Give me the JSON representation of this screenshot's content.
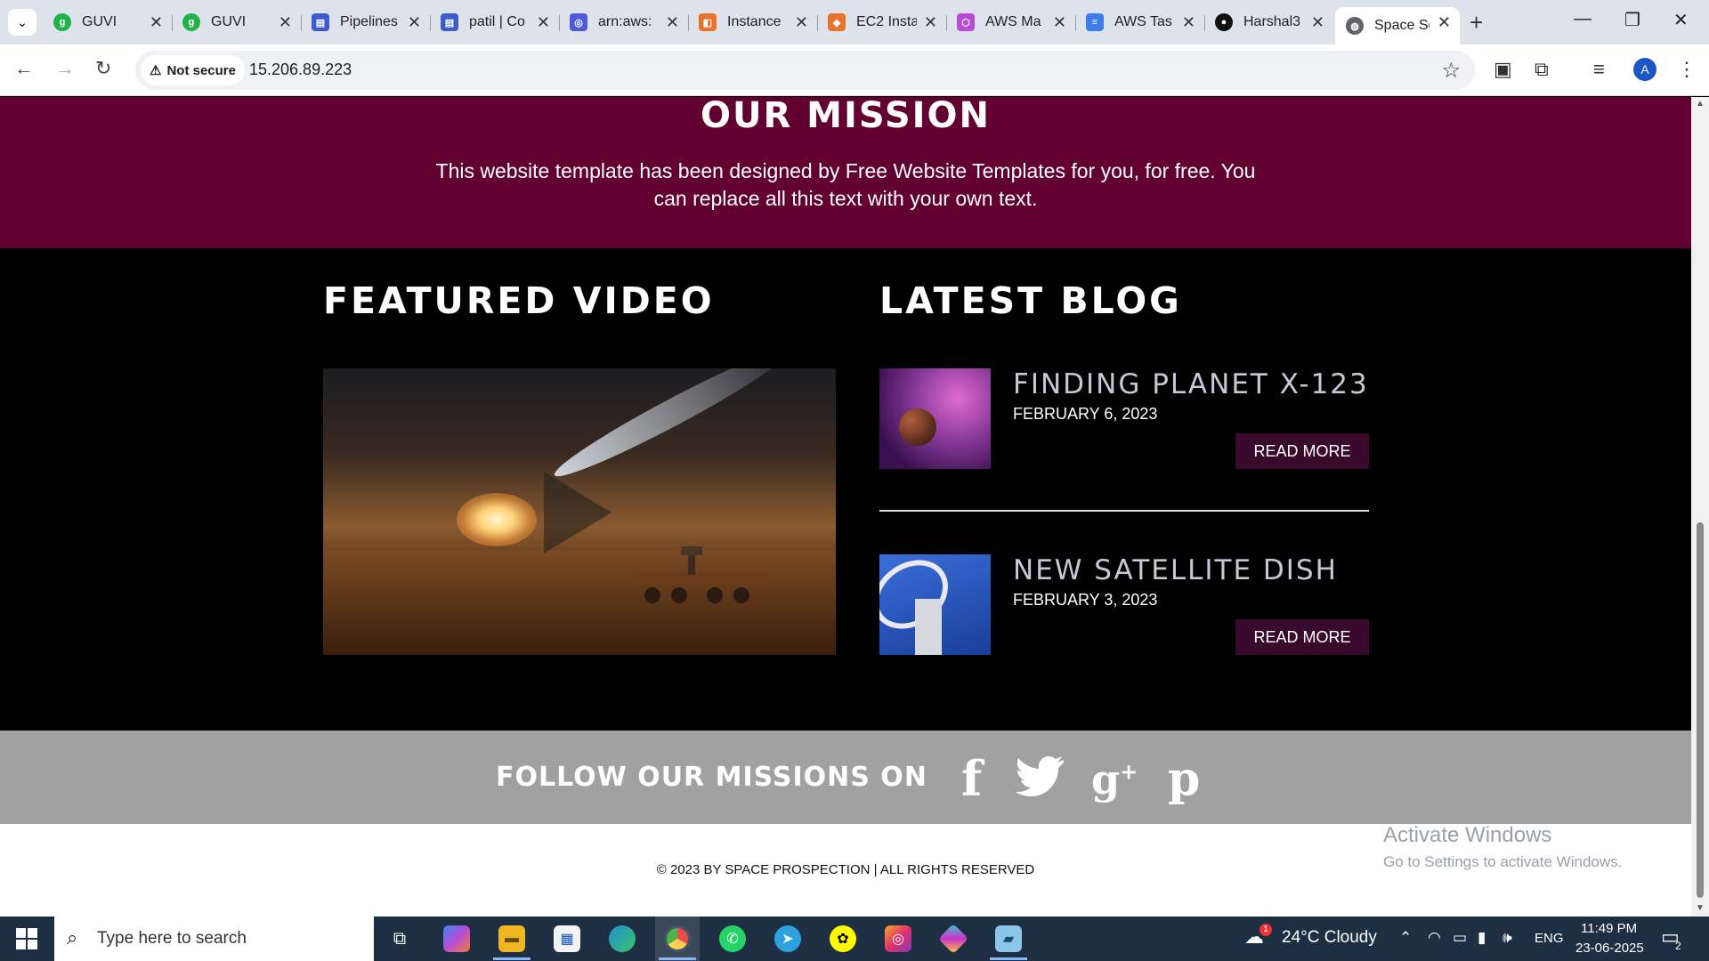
{
  "browser": {
    "tabs": [
      {
        "title": "GUVI",
        "icon": "guvi-icon",
        "color": "#22b24c"
      },
      {
        "title": "GUVI",
        "icon": "guvi-icon",
        "color": "#22b24c"
      },
      {
        "title": "Pipelines",
        "icon": "azure-devops-icon",
        "color": "#3b5ccd"
      },
      {
        "title": "patil | Co",
        "icon": "azure-devops-icon",
        "color": "#3b5ccd"
      },
      {
        "title": "arn:aws:",
        "icon": "aws-icon",
        "color": "#4d5bd8"
      },
      {
        "title": "Instance",
        "icon": "aws-ec2-icon",
        "color": "#e8732c"
      },
      {
        "title": "EC2 Insta",
        "icon": "aws-ec2-icon",
        "color": "#e8732c"
      },
      {
        "title": "AWS Ma",
        "icon": "aws-box-icon",
        "color": "#b84bd6"
      },
      {
        "title": "AWS Tas",
        "icon": "google-docs-icon",
        "color": "#3c7bf0"
      },
      {
        "title": "Harshal3",
        "icon": "github-icon",
        "color": "#111111"
      },
      {
        "title": "Space Sc",
        "icon": "globe-icon",
        "color": "#5f6368",
        "active": true
      }
    ],
    "address": {
      "security_label": "Not secure",
      "url": "15.206.89.223"
    },
    "profile_initial": "A"
  },
  "site": {
    "mission": {
      "title": "OUR MISSION",
      "text": "This website template has been designed by Free Website Templates for you, for free. You can replace all this text with your own text."
    },
    "featured_video": {
      "title": "FEATURED VIDEO"
    },
    "latest_blog": {
      "title": "LATEST BLOG",
      "posts": [
        {
          "title": "FINDING PLANET X-123",
          "date": "FEBRUARY 6, 2023",
          "button": "READ MORE"
        },
        {
          "title": "NEW SATELLITE DISH",
          "date": "FEBRUARY 3, 2023",
          "button": "READ MORE"
        }
      ]
    },
    "follow": {
      "title": "FOLLOW OUR MISSIONS ON",
      "networks": [
        "f",
        "twitter",
        "g+",
        "pinterest"
      ]
    },
    "footer": {
      "copyright": "© 2023 BY SPACE PROSPECTION | ALL RIGHTS RESERVED"
    }
  },
  "watermark": {
    "line1": "Activate Windows",
    "line2": "Go to Settings to activate Windows."
  },
  "taskbar": {
    "search_placeholder": "Type here to search",
    "weather": "24°C  Cloudy",
    "weather_badge": "1",
    "language": "ENG",
    "time": "11:49 PM",
    "date": "23-06-2025",
    "notifications": "2"
  }
}
